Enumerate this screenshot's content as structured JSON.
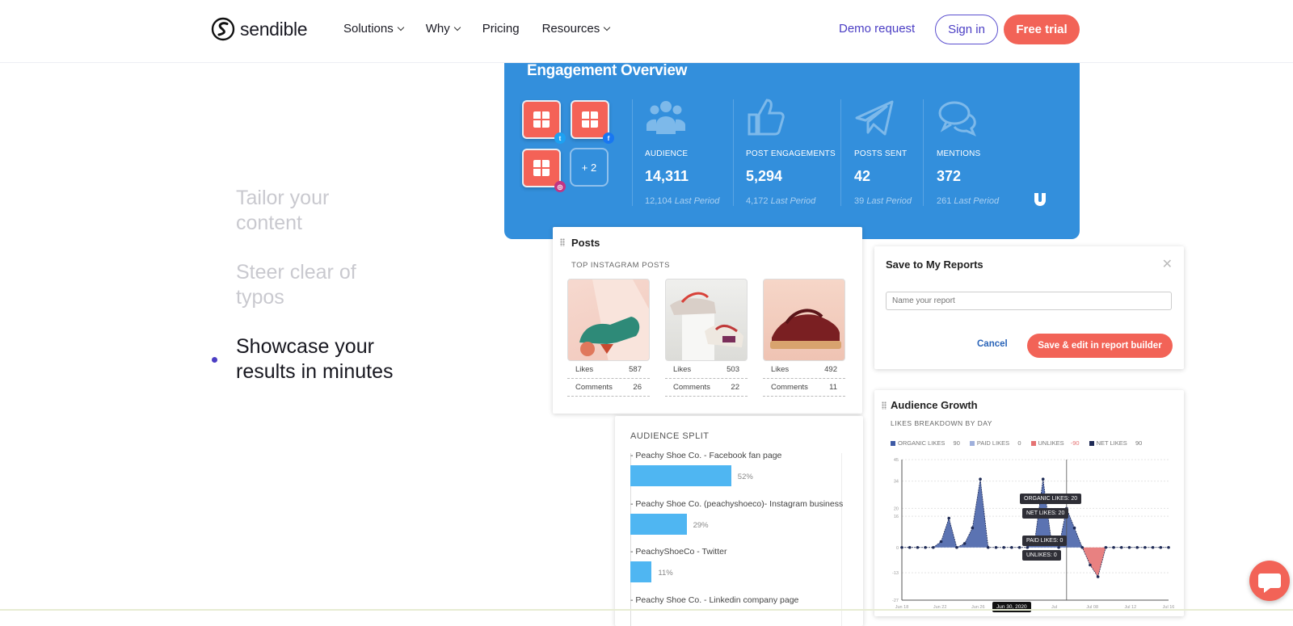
{
  "nav": {
    "brand": "sendible",
    "menu": [
      "Solutions",
      "Why",
      "Pricing",
      "Resources"
    ],
    "demo": "Demo request",
    "signin": "Sign in",
    "trial": "Free trial",
    "colors": {
      "accent": "#4b3ec4",
      "cta": "#f26357"
    }
  },
  "steps": [
    {
      "text": "Tailor your content"
    },
    {
      "text": "Steer clear of typos"
    },
    {
      "text": "Showcase your results in minutes"
    }
  ],
  "engagement": {
    "title": "Engagement Overview",
    "more": "+ 2",
    "stats": [
      {
        "label": "AUDIENCE",
        "value": "14,311",
        "prev": "12,104",
        "prev_label": "Last Period",
        "icon": "audience-icon"
      },
      {
        "label": "POST ENGAGEMENTS",
        "value": "5,294",
        "prev": "4,172",
        "prev_label": "Last Period",
        "icon": "thumbs-up-icon"
      },
      {
        "label": "POSTS SENT",
        "value": "42",
        "prev": "39",
        "prev_label": "Last Period",
        "icon": "paper-plane-icon"
      },
      {
        "label": "MENTIONS",
        "value": "372",
        "prev": "261",
        "prev_label": "Last Period",
        "icon": "chat-bubbles-icon"
      }
    ],
    "color": "#338fdc"
  },
  "posts": {
    "title": "Posts",
    "subtitle": "TOP INSTAGRAM POSTS",
    "items": [
      {
        "likes_label": "Likes",
        "likes": "587",
        "comments_label": "Comments",
        "comments": "26"
      },
      {
        "likes_label": "Likes",
        "likes": "503",
        "comments_label": "Comments",
        "comments": "22"
      },
      {
        "likes_label": "Likes",
        "likes": "492",
        "comments_label": "Comments",
        "comments": "11"
      }
    ]
  },
  "modal": {
    "title": "Save to My Reports",
    "placeholder": "Name your report",
    "cancel": "Cancel",
    "save": "Save & edit in report builder"
  },
  "split": {
    "title": "AUDIENCE SPLIT",
    "rows": [
      {
        "label": "Peachy Shoe Co. - Facebook fan page",
        "pct": "52%",
        "value": 52
      },
      {
        "label": "Peachy Shoe Co. (peachyshoeco)- Instagram business",
        "pct": "29%",
        "value": 29
      },
      {
        "label": "PeachyShoeCo - Twitter",
        "pct": "11%",
        "value": 11
      },
      {
        "label": "Peachy Shoe Co. - Linkedin company page",
        "pct": "",
        "value": 0
      }
    ]
  },
  "growth": {
    "title": "Audience Growth",
    "subtitle": "LIKES BREAKDOWN BY DAY",
    "legend": [
      {
        "name": "ORGANIC LIKES",
        "value": "90",
        "color": "#3e5aa5"
      },
      {
        "name": "PAID LIKES",
        "value": "0",
        "color": "#9fb0dc"
      },
      {
        "name": "UNLIKES",
        "value": "-90",
        "color": "#e57373"
      },
      {
        "name": "NET LIKES",
        "value": "90",
        "color": "#1e2a55"
      }
    ],
    "tooltips": [
      "ORGANIC LIKES: 20",
      "NET LIKES: 20",
      "PAID LIKES: 0",
      "UNLIKES: 0"
    ],
    "date_badge": "Jun 30, 2020"
  },
  "chart_data": {
    "type": "area",
    "title": "Audience Growth",
    "subtitle": "LIKES BREAKDOWN BY DAY",
    "ylim": [
      -27,
      45
    ],
    "yticks": [
      45,
      34,
      20,
      16,
      0,
      -13,
      -27
    ],
    "xticks": [
      "Jun 18",
      "Jun 22",
      "Jun 26",
      "Jun 30, 2020",
      "Jul",
      "Jul 08",
      "Jul 12",
      "Jul 16"
    ],
    "series": [
      {
        "name": "ORGANIC LIKES",
        "values": [
          0,
          0,
          0,
          0,
          0,
          3,
          15,
          0,
          2,
          10,
          35,
          0,
          0,
          0,
          0,
          0,
          0,
          5,
          35,
          5,
          0,
          20,
          10,
          0,
          0,
          0,
          0,
          0,
          0,
          0,
          0,
          0,
          0,
          0,
          0
        ]
      },
      {
        "name": "UNLIKES",
        "values": [
          0,
          0,
          0,
          0,
          0,
          0,
          0,
          0,
          0,
          0,
          0,
          0,
          0,
          0,
          0,
          0,
          0,
          0,
          0,
          0,
          0,
          0,
          0,
          0,
          -9,
          -15,
          0,
          0,
          0,
          0,
          0,
          0,
          0,
          0,
          0
        ]
      }
    ]
  }
}
